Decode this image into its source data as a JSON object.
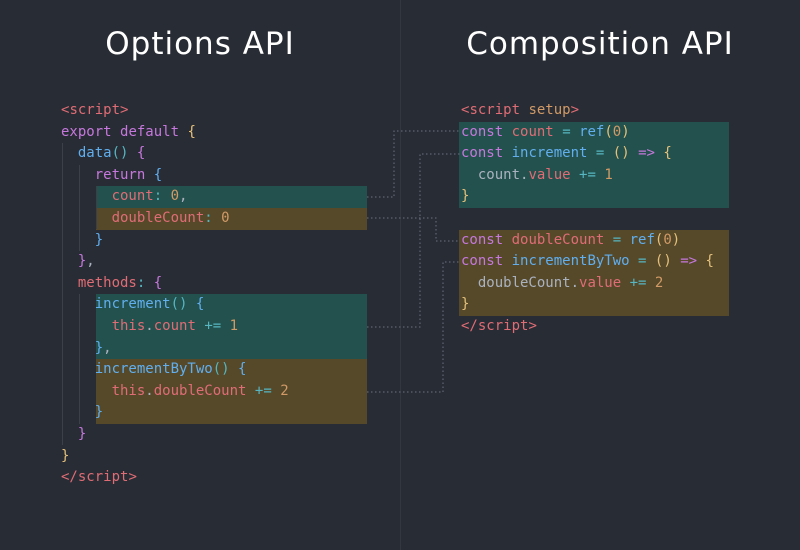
{
  "titles": {
    "left": "Options API",
    "right": "Composition API"
  },
  "colors": {
    "background": "#282c34",
    "teal_highlight": "#23514d",
    "olive_highlight": "#55492a"
  },
  "options_code": [
    [
      [
        "t",
        "<"
      ],
      [
        "t",
        "script"
      ],
      [
        "t",
        ">"
      ]
    ],
    [
      [
        "k",
        "export"
      ],
      [
        "p",
        " "
      ],
      [
        "k",
        "default"
      ],
      [
        "p",
        " "
      ],
      [
        "y",
        "{"
      ]
    ],
    [
      [
        "p",
        "  "
      ],
      [
        "f",
        "data"
      ],
      [
        "c",
        "()"
      ],
      [
        "p",
        " "
      ],
      [
        "k",
        "{"
      ]
    ],
    [
      [
        "p",
        "    "
      ],
      [
        "k",
        "return"
      ],
      [
        "p",
        " "
      ],
      [
        "f",
        "{"
      ]
    ],
    [
      [
        "p",
        "      "
      ],
      [
        "t",
        "count"
      ],
      [
        "c",
        ":"
      ],
      [
        "p",
        " "
      ],
      [
        "n",
        "0"
      ],
      [
        "p",
        ","
      ]
    ],
    [
      [
        "p",
        "      "
      ],
      [
        "t",
        "doubleCount"
      ],
      [
        "c",
        ":"
      ],
      [
        "p",
        " "
      ],
      [
        "n",
        "0"
      ]
    ],
    [
      [
        "p",
        "    "
      ],
      [
        "f",
        "}"
      ]
    ],
    [
      [
        "p",
        "  "
      ],
      [
        "k",
        "}"
      ],
      [
        "p",
        ","
      ]
    ],
    [
      [
        "p",
        "  "
      ],
      [
        "t",
        "methods"
      ],
      [
        "c",
        ":"
      ],
      [
        "p",
        " "
      ],
      [
        "k",
        "{"
      ]
    ],
    [
      [
        "p",
        "    "
      ],
      [
        "f",
        "increment"
      ],
      [
        "c",
        "()"
      ],
      [
        "p",
        " "
      ],
      [
        "f",
        "{"
      ]
    ],
    [
      [
        "p",
        "      "
      ],
      [
        "t",
        "this"
      ],
      [
        "p",
        "."
      ],
      [
        "t",
        "count"
      ],
      [
        "p",
        " "
      ],
      [
        "c",
        "+="
      ],
      [
        "p",
        " "
      ],
      [
        "n",
        "1"
      ]
    ],
    [
      [
        "p",
        "    "
      ],
      [
        "f",
        "}"
      ],
      [
        "p",
        ","
      ]
    ],
    [
      [
        "p",
        "    "
      ],
      [
        "f",
        "incrementByTwo"
      ],
      [
        "c",
        "()"
      ],
      [
        "p",
        " "
      ],
      [
        "f",
        "{"
      ]
    ],
    [
      [
        "p",
        "      "
      ],
      [
        "t",
        "this"
      ],
      [
        "p",
        "."
      ],
      [
        "t",
        "doubleCount"
      ],
      [
        "p",
        " "
      ],
      [
        "c",
        "+="
      ],
      [
        "p",
        " "
      ],
      [
        "n",
        "2"
      ]
    ],
    [
      [
        "p",
        "    "
      ],
      [
        "f",
        "}"
      ]
    ],
    [
      [
        "p",
        "  "
      ],
      [
        "k",
        "}"
      ]
    ],
    [
      [
        "y",
        "}"
      ]
    ],
    [
      [
        "t",
        "</"
      ],
      [
        "t",
        "script"
      ],
      [
        "t",
        ">"
      ]
    ]
  ],
  "composition_code": [
    [
      [
        "t",
        "<"
      ],
      [
        "t",
        "script"
      ],
      [
        "p",
        " "
      ],
      [
        "n",
        "setup"
      ],
      [
        "t",
        ">"
      ]
    ],
    [
      [
        "k",
        "const"
      ],
      [
        "p",
        " "
      ],
      [
        "t",
        "count"
      ],
      [
        "p",
        " "
      ],
      [
        "c",
        "="
      ],
      [
        "p",
        " "
      ],
      [
        "f",
        "ref"
      ],
      [
        "y",
        "("
      ],
      [
        "n",
        "0"
      ],
      [
        "y",
        ")"
      ]
    ],
    [
      [
        "k",
        "const"
      ],
      [
        "p",
        " "
      ],
      [
        "f",
        "increment"
      ],
      [
        "p",
        " "
      ],
      [
        "c",
        "="
      ],
      [
        "p",
        " "
      ],
      [
        "y",
        "()"
      ],
      [
        "p",
        " "
      ],
      [
        "k",
        "=>"
      ],
      [
        "p",
        " "
      ],
      [
        "y",
        "{"
      ]
    ],
    [
      [
        "p",
        "  "
      ],
      [
        "p",
        "count"
      ],
      [
        "p",
        "."
      ],
      [
        "t",
        "value"
      ],
      [
        "p",
        " "
      ],
      [
        "c",
        "+="
      ],
      [
        "p",
        " "
      ],
      [
        "n",
        "1"
      ]
    ],
    [
      [
        "y",
        "}"
      ]
    ],
    [
      [
        "p",
        ""
      ]
    ],
    [
      [
        "k",
        "const"
      ],
      [
        "p",
        " "
      ],
      [
        "t",
        "doubleCount"
      ],
      [
        "p",
        " "
      ],
      [
        "c",
        "="
      ],
      [
        "p",
        " "
      ],
      [
        "f",
        "ref"
      ],
      [
        "y",
        "("
      ],
      [
        "n",
        "0"
      ],
      [
        "y",
        ")"
      ]
    ],
    [
      [
        "k",
        "const"
      ],
      [
        "p",
        " "
      ],
      [
        "f",
        "incrementByTwo"
      ],
      [
        "p",
        " "
      ],
      [
        "c",
        "="
      ],
      [
        "p",
        " "
      ],
      [
        "y",
        "()"
      ],
      [
        "p",
        " "
      ],
      [
        "k",
        "=>"
      ],
      [
        "p",
        " "
      ],
      [
        "y",
        "{"
      ]
    ],
    [
      [
        "p",
        "  "
      ],
      [
        "p",
        "doubleCount"
      ],
      [
        "p",
        "."
      ],
      [
        "t",
        "value"
      ],
      [
        "p",
        " "
      ],
      [
        "c",
        "+="
      ],
      [
        "p",
        " "
      ],
      [
        "n",
        "2"
      ]
    ],
    [
      [
        "y",
        "}"
      ]
    ],
    [
      [
        "t",
        "</"
      ],
      [
        "t",
        "script"
      ],
      [
        "t",
        ">"
      ]
    ]
  ]
}
